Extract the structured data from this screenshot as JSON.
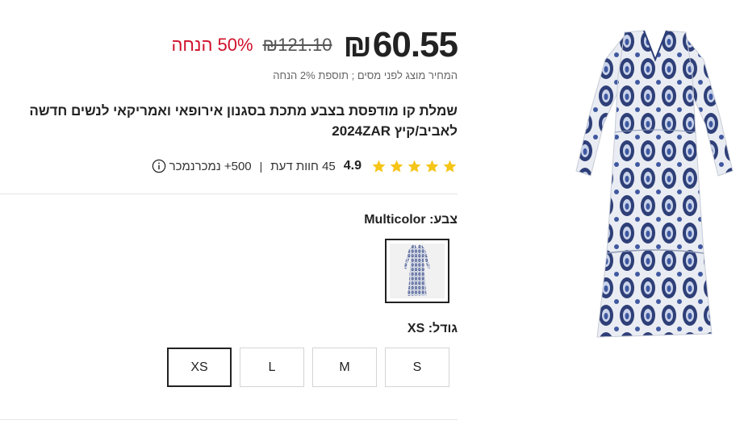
{
  "product": {
    "price_current": "60.55",
    "currency": "₪",
    "price_old": "₪121.10",
    "discount": "50% הנחה",
    "tax_note": "המחיר מוצג לפני מסים ; תוספת 2% הנחה",
    "title": "שמלת קו מודפסת בצבע מתכת בסגנון אירופאי ואמריקאי לנשים חדשה לאביב/קיץ 2024ZAR",
    "rating": {
      "score": "4.9",
      "stars": 5,
      "reviews": "45 חוות דעת",
      "separator": "|",
      "sold": "500+ נמכרנמכר"
    },
    "colors": {
      "label": "צבע:",
      "selected": "Multicolor"
    },
    "sizes": {
      "label": "גודל:",
      "selected": "XS",
      "options": [
        "S",
        "M",
        "L",
        "XS"
      ]
    }
  },
  "theme": {
    "accent_red": "#d0102a",
    "star_color": "#f5c518",
    "dress_blue": "#2e3f78"
  }
}
